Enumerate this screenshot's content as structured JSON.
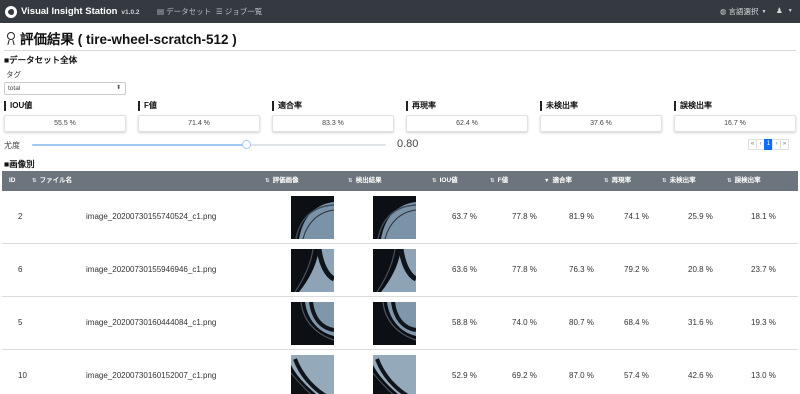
{
  "navbar": {
    "brand": "Visual Insight Station",
    "version": "v1.0.2",
    "links": [
      {
        "icon": "table-icon",
        "glyph": "▤",
        "label": "データセット"
      },
      {
        "icon": "list-icon",
        "glyph": "☰",
        "label": "ジョブ一覧"
      }
    ],
    "language": {
      "icon": "globe-icon",
      "glyph": "◍",
      "label": "言語選択"
    },
    "user": {
      "icon": "user-icon",
      "glyph": "♟"
    }
  },
  "page": {
    "title": "評価結果 ( tire-wheel-scratch-512 )",
    "dataset_section": "■データセット全体",
    "tag_label": "タグ",
    "tag_value": "total",
    "image_section": "■画像別"
  },
  "metrics": [
    {
      "label": "IOU値",
      "value": "55.5 %"
    },
    {
      "label": "F値",
      "value": "71.4 %"
    },
    {
      "label": "適合率",
      "value": "83.3 %"
    },
    {
      "label": "再現率",
      "value": "62.4 %"
    },
    {
      "label": "未検出率",
      "value": "37.6 %"
    },
    {
      "label": "誤検出率",
      "value": "16.7 %"
    }
  ],
  "likelihood": {
    "label": "尤度",
    "value": "0.80",
    "fraction": 0.8
  },
  "pagination": {
    "items": [
      "«",
      "‹",
      "1",
      "›",
      "»"
    ],
    "current": "1"
  },
  "table": {
    "headers": [
      "ID",
      "ファイル名",
      "評価画像",
      "検出結果",
      "IOU値",
      "F値",
      "適合率",
      "再現率",
      "未検出率",
      "誤検出率"
    ],
    "rows": [
      {
        "id": "2",
        "file": "image_20200730155740524_c1.png",
        "iou": "63.7 %",
        "f": "77.8 %",
        "precision": "81.9 %",
        "recall": "74.1 %",
        "miss": "25.9 %",
        "false": "18.1 %"
      },
      {
        "id": "6",
        "file": "image_20200730155946946_c1.png",
        "iou": "63.6 %",
        "f": "77.8 %",
        "precision": "76.3 %",
        "recall": "79.2 %",
        "miss": "20.8 %",
        "false": "23.7 %"
      },
      {
        "id": "5",
        "file": "image_20200730160444084_c1.png",
        "iou": "58.8 %",
        "f": "74.0 %",
        "precision": "80.7 %",
        "recall": "68.4 %",
        "miss": "31.6 %",
        "false": "19.3 %"
      },
      {
        "id": "10",
        "file": "image_20200730160152007_c1.png",
        "iou": "52.9 %",
        "f": "69.2 %",
        "precision": "87.0 %",
        "recall": "57.4 %",
        "miss": "42.6 %",
        "false": "13.0 %"
      }
    ]
  },
  "colors": {
    "navbar": "#343a40",
    "table_header": "#6c757d",
    "accent": "#0d6efd",
    "slider": "#9ec9f2"
  }
}
